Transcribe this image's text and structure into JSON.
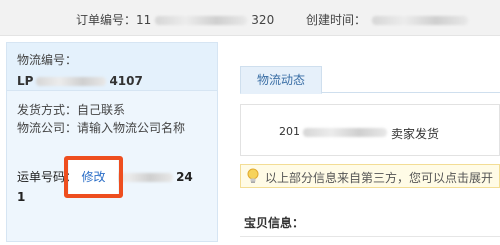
{
  "order": {
    "number_label": "订单编号：",
    "number_prefix": "11",
    "number_suffix": "320",
    "created_label": "创建时间："
  },
  "logistics": {
    "number_label": "物流编号：",
    "number_prefix": "LP",
    "number_suffix": "4107",
    "shipping_method_label": "发货方式：",
    "shipping_method_value": "自己联系",
    "company_label": "物流公司：",
    "company_value": "请输入物流公司名称",
    "waybill_label": "运单号码：",
    "waybill_prefix": "912",
    "waybill_suffix": "24",
    "waybill_line2": "1",
    "edit_label": "修改"
  },
  "tabs": [
    {
      "label": "物流动态",
      "active": true
    }
  ],
  "log": {
    "date_prefix": "201",
    "status": "卖家发货"
  },
  "notice": {
    "text": "以上部分信息来自第三方，您可以点击展开"
  },
  "goods": {
    "title": "宝贝信息："
  },
  "colors": {
    "highlight": "#ee4e1f",
    "link": "#2b6ec7",
    "panel_bg": "#eef6fd",
    "notice_bg": "#fffbe6"
  },
  "icons": {
    "notice": "lightbulb-icon"
  }
}
